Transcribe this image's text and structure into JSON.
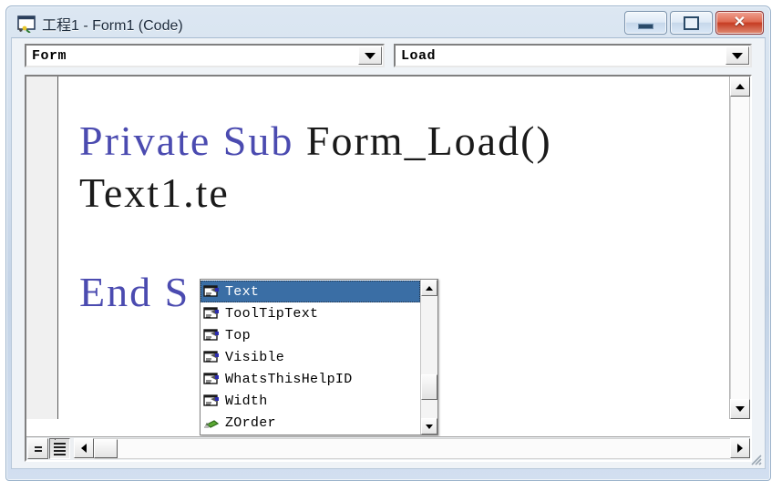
{
  "window": {
    "title": "工程1 - Form1 (Code)",
    "app_icon": "vb-code-window-icon",
    "controls": {
      "minimize_label": "Minimize",
      "maximize_label": "Restore",
      "close_label": "✕"
    },
    "accent_title_color": "#1b2a3c",
    "frame_color": "#c3d3e6"
  },
  "toolbar": {
    "object_combo": {
      "value": "Form",
      "arrow_icon": "chevron-down-icon"
    },
    "procedure_combo": {
      "value": "Load",
      "arrow_icon": "chevron-down-icon"
    }
  },
  "code": {
    "lines": [
      {
        "keyword": "Private Sub ",
        "rest": "Form_Load()"
      },
      {
        "keyword": "",
        "rest": "Text1.te"
      },
      {
        "keyword": "End S",
        "rest": ""
      }
    ],
    "keyword_color": "#4b4bb0",
    "text_color": "#1a1a1a",
    "background": "#ffffff"
  },
  "intellisense": {
    "selected_index": 0,
    "highlight_color": "#3a6ea5",
    "items": [
      {
        "label": "Text",
        "icon": "property-icon"
      },
      {
        "label": "ToolTipText",
        "icon": "property-icon"
      },
      {
        "label": "Top",
        "icon": "property-icon"
      },
      {
        "label": "Visible",
        "icon": "property-icon"
      },
      {
        "label": "WhatsThisHelpID",
        "icon": "property-icon"
      },
      {
        "label": "Width",
        "icon": "property-icon"
      },
      {
        "label": "ZOrder",
        "icon": "method-icon"
      }
    ],
    "scroll": {
      "up_icon": "scroll-up-icon",
      "down_icon": "scroll-down-icon"
    }
  },
  "status_bar": {
    "procedure_view_label": "Procedure View",
    "full_module_view_label": "Full Module View",
    "hscroll": {
      "left_icon": "scroll-left-icon",
      "right_icon": "scroll-right-icon"
    },
    "grip_icon": "resize-grip-icon"
  },
  "scrollbars": {
    "vertical": {
      "up_icon": "scroll-up-icon",
      "down_icon": "scroll-down-icon"
    }
  }
}
